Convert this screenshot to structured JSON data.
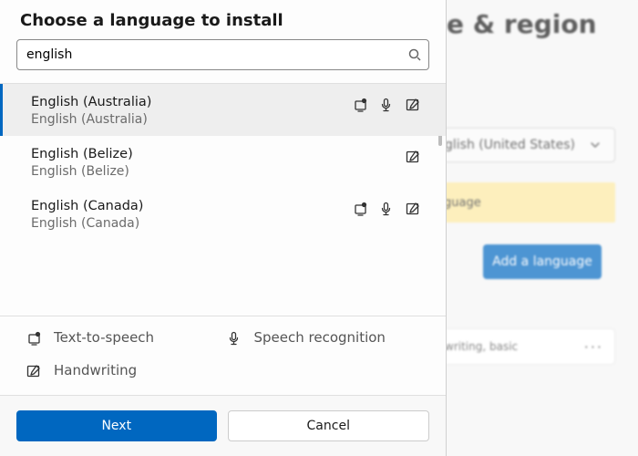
{
  "background": {
    "header": "e & region",
    "dropdown_value": "glish (United States)",
    "banner_text": "guage",
    "add_button": "Add a language",
    "row_text": "writing, basic"
  },
  "dialog": {
    "title": "Choose a language to install",
    "search_value": "english",
    "results": [
      {
        "name": "English (Australia)",
        "native": "English (Australia)",
        "tts": true,
        "speech": true,
        "handwriting": true
      },
      {
        "name": "English (Belize)",
        "native": "English (Belize)",
        "tts": false,
        "speech": false,
        "handwriting": true
      },
      {
        "name": "English (Canada)",
        "native": "English (Canada)",
        "tts": true,
        "speech": true,
        "handwriting": true
      }
    ],
    "legend": {
      "tts": "Text-to-speech",
      "speech": "Speech recognition",
      "handwriting": "Handwriting"
    },
    "buttons": {
      "next": "Next",
      "cancel": "Cancel"
    }
  }
}
